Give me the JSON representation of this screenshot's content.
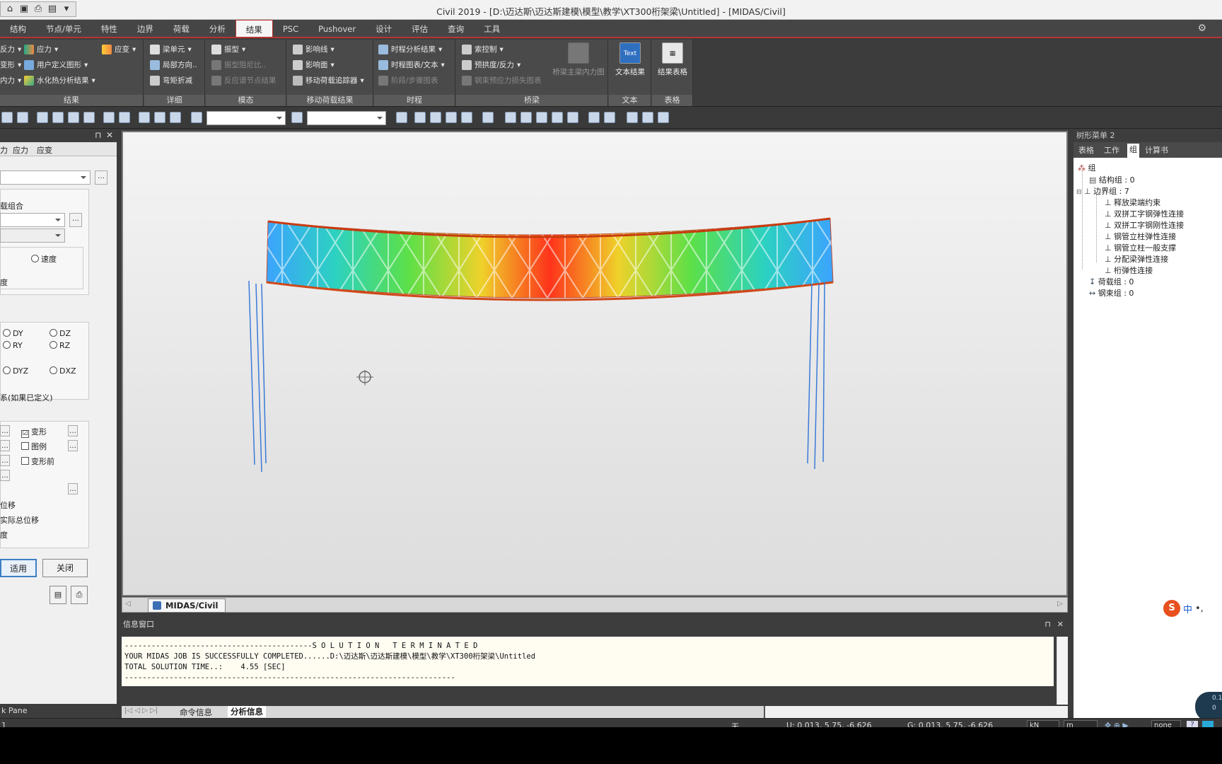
{
  "window_title": "Civil 2019 - [D:\\迈达斯\\迈达斯建模\\模型\\教学\\XT300桁架梁\\Untitled] - [MIDAS/Civil]",
  "menu_tabs": [
    "结构",
    "节点/单元",
    "特性",
    "边界",
    "荷载",
    "分析",
    "结果",
    "PSC",
    "Pushover",
    "设计",
    "评估",
    "查询",
    "工具"
  ],
  "active_tab": "结果",
  "ribbon": {
    "group1": {
      "label": "结果",
      "items": [
        "反力",
        "应力",
        "应变",
        "变形",
        "用户定义图形",
        "内力",
        "水化热分析结果"
      ]
    },
    "group2": {
      "label": "详细",
      "items": [
        "梁单元",
        "局部方向..",
        "弯矩折减"
      ]
    },
    "group3": {
      "label": "模态",
      "items": [
        "振型",
        "振型阻尼比..",
        "反应谱节点结果"
      ]
    },
    "group4": {
      "label": "移动荷载结果",
      "items": [
        "影响线",
        "影响面",
        "移动荷载追踪器"
      ]
    },
    "group5": {
      "label": "时程",
      "items": [
        "时程分析结果",
        "时程图表/文本",
        "阶段/步骤图表"
      ]
    },
    "group6": {
      "label": "桥梁",
      "items": [
        "索控制",
        "预拱度/反力",
        "钢束预应力损失图表",
        "桥梁主梁内力图"
      ]
    },
    "group7": {
      "label": "文本",
      "big": "文本结果",
      "icon": "Text"
    },
    "group8": {
      "label": "表格",
      "big": "结果表格"
    }
  },
  "left_pane": {
    "tabs": [
      "力",
      "应力",
      "应变"
    ],
    "load_comb_label": "载组合",
    "speed_label": "速度",
    "accel_label": "度",
    "radios": [
      "DY",
      "DZ",
      "RY",
      "RZ",
      "DYZ",
      "DXZ"
    ],
    "coord_label": "系(如果已定义)",
    "checks": [
      {
        "label": "变形",
        "checked": true,
        "mark": "☑"
      },
      {
        "label": "图例",
        "checked": false,
        "mark": ""
      },
      {
        "label": "变形前",
        "checked": false,
        "mark": ""
      }
    ],
    "disp_label": "位移",
    "real_disp_label": "实际总位移",
    "small_label": "度",
    "apply_button": "适用",
    "close_button": "关闭",
    "task_pane": "k Pane"
  },
  "viewport": {
    "tab_label": "MIDAS/Civil"
  },
  "info_window": {
    "title": "信息窗口",
    "lines": [
      "------------------------------------------S O L U T I O N   T E R M I N A T E D",
      "YOUR MIDAS JOB IS SUCCESSFULLY COMPLETED......D:\\迈达斯\\迈达斯建模\\模型\\教学\\XT300桁架梁\\Untitled",
      "TOTAL SOLUTION TIME..:    4.55 [SEC]",
      "--------------------------------------------------------------------------"
    ],
    "tabs": [
      "命令信息",
      "分析信息"
    ]
  },
  "right_pane": {
    "title": "树形菜单 2",
    "tabs": [
      "表格",
      "工作",
      "组",
      "计算书"
    ],
    "active_tab": "组",
    "tree": {
      "root": "组",
      "structure_group": "结构组 : 0",
      "boundary_group": "边界组 : 7",
      "boundary_items": [
        "释放梁端约束",
        "双拼工字钢弹性连接",
        "双拼工字钢刚性连接",
        "钢管立柱弹性连接",
        "钢管立柱一般支撑",
        "分配梁弹性连接",
        "桁弹性连接"
      ],
      "load_group": "荷载组 : 0",
      "tendon_group": "钢束组 : 0"
    }
  },
  "status": {
    "none": "无",
    "u_coord": "U: 0.013, 5.75, -6.626",
    "g_coord": "G: 0.013, 5.75, -6.626",
    "unit_force": "kN",
    "unit_length": "m",
    "none_combo": "none",
    "left_item": "1"
  },
  "ime": {
    "label": "中",
    "extra": "•,"
  },
  "compass": {
    "a": "0.1",
    "b": "0"
  },
  "colors": {
    "accent": "#b33333",
    "ribbon_bg": "#4a4a4a",
    "viewport_top": "#f4f4f4"
  }
}
